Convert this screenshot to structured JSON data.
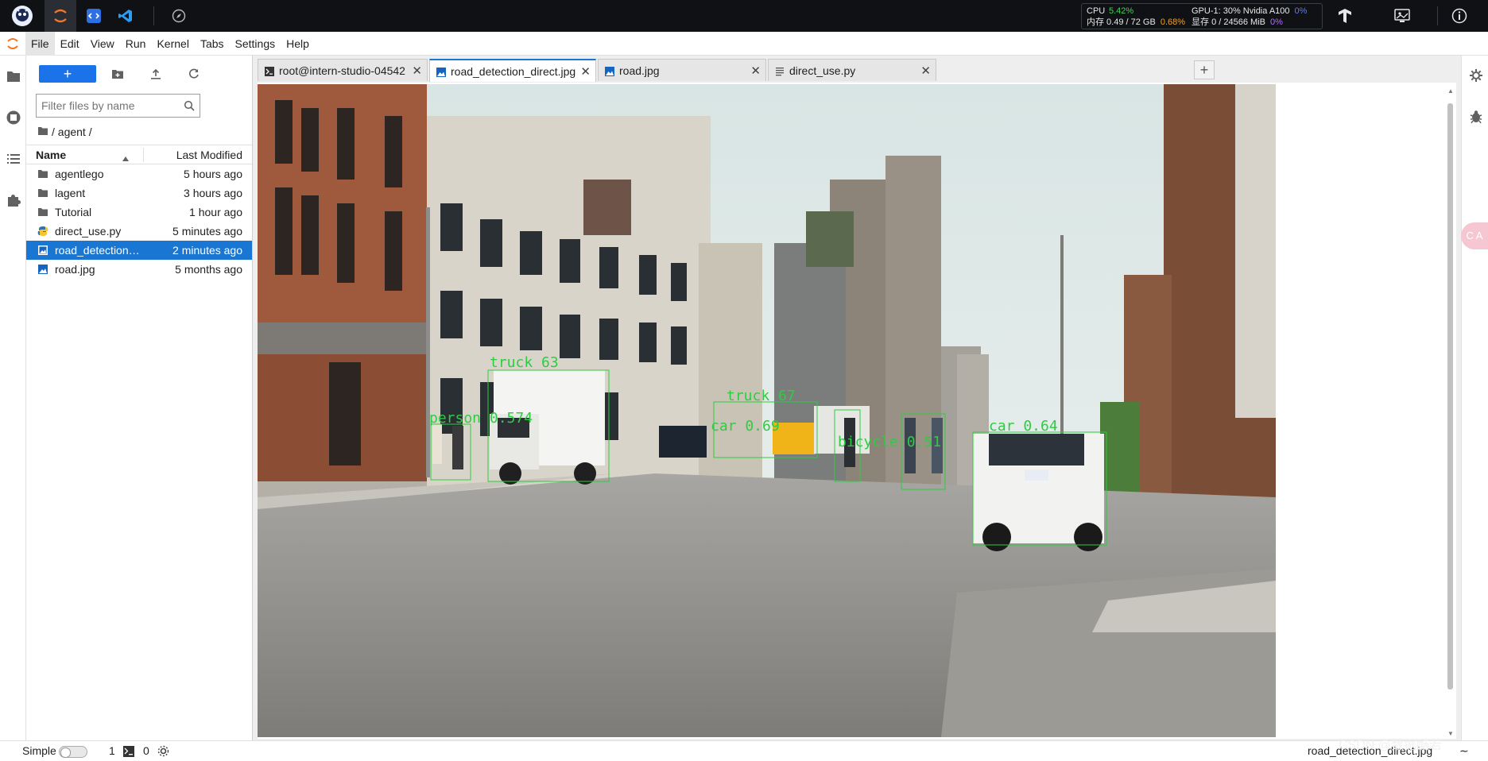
{
  "sysstats": {
    "cpu_label": "CPU",
    "cpu_value": "5.42%",
    "gpu_label": "GPU-1: 30% Nvidia A100",
    "gpu_value": "0%",
    "mem_label": "内存 0.49 / 72 GB",
    "mem_value": "0.68%",
    "vram_label": "显存 0 / 24566 MiB",
    "vram_value": "0%"
  },
  "menu": [
    "File",
    "Edit",
    "View",
    "Run",
    "Kernel",
    "Tabs",
    "Settings",
    "Help"
  ],
  "filebrowser": {
    "new_label": "+",
    "filter_placeholder": "Filter files by name",
    "breadcrumb": "/ agent /",
    "col_name": "Name",
    "col_modified": "Last Modified",
    "files": [
      {
        "name": "agentlego",
        "modified": "5 hours ago",
        "type": "folder"
      },
      {
        "name": "lagent",
        "modified": "3 hours ago",
        "type": "folder"
      },
      {
        "name": "Tutorial",
        "modified": "1 hour ago",
        "type": "folder"
      },
      {
        "name": "direct_use.py",
        "modified": "5 minutes ago",
        "type": "python"
      },
      {
        "name": "road_detection_direct.jpg",
        "modified": "2 minutes ago",
        "type": "image",
        "selected": true
      },
      {
        "name": "road.jpg",
        "modified": "5 months ago",
        "type": "image"
      }
    ]
  },
  "tabs": [
    {
      "label": "root@intern-studio-04542",
      "icon": "terminal-icon",
      "active": false
    },
    {
      "label": "road_detection_direct.jpg",
      "icon": "image-icon",
      "active": true
    },
    {
      "label": "road.jpg",
      "icon": "image-icon",
      "active": false
    },
    {
      "label": "direct_use.py",
      "icon": "text-file-icon",
      "active": false
    }
  ],
  "detections": [
    {
      "label": "truck 63"
    },
    {
      "label": "person 0.574"
    },
    {
      "label": "car 0.69"
    },
    {
      "label": "truck 67"
    },
    {
      "label": "bicycle 0.51"
    },
    {
      "label": "car 0.64"
    }
  ],
  "statusbar": {
    "mode": "Simple",
    "kernels": "1",
    "terminals": "0",
    "right_text": "road_detection_direct.jpg",
    "zoom_icon": "∼"
  },
  "right_badge": "C A",
  "watermark": "CSDN @数据酷若",
  "colors": {
    "accent": "#1976d2",
    "topbar": "#0f1115",
    "detection_box": "#2ecc40"
  }
}
